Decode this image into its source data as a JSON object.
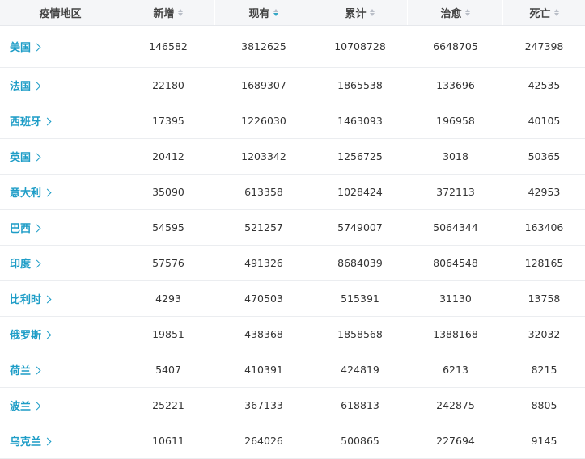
{
  "header": {
    "columns": [
      {
        "label": "疫情地区",
        "sortable": false,
        "sort": "none"
      },
      {
        "label": "新增",
        "sortable": true,
        "sort": "none"
      },
      {
        "label": "现有",
        "sortable": true,
        "sort": "desc"
      },
      {
        "label": "累计",
        "sortable": true,
        "sort": "none"
      },
      {
        "label": "治愈",
        "sortable": true,
        "sort": "none"
      },
      {
        "label": "死亡",
        "sortable": true,
        "sort": "none"
      }
    ]
  },
  "rows": [
    {
      "region": "美国",
      "new": "146582",
      "current": "3812625",
      "total": "10708728",
      "cured": "6648705",
      "dead": "247398"
    },
    {
      "region": "法国",
      "new": "22180",
      "current": "1689307",
      "total": "1865538",
      "cured": "133696",
      "dead": "42535"
    },
    {
      "region": "西班牙",
      "new": "17395",
      "current": "1226030",
      "total": "1463093",
      "cured": "196958",
      "dead": "40105"
    },
    {
      "region": "英国",
      "new": "20412",
      "current": "1203342",
      "total": "1256725",
      "cured": "3018",
      "dead": "50365"
    },
    {
      "region": "意大利",
      "new": "35090",
      "current": "613358",
      "total": "1028424",
      "cured": "372113",
      "dead": "42953"
    },
    {
      "region": "巴西",
      "new": "54595",
      "current": "521257",
      "total": "5749007",
      "cured": "5064344",
      "dead": "163406"
    },
    {
      "region": "印度",
      "new": "57576",
      "current": "491326",
      "total": "8684039",
      "cured": "8064548",
      "dead": "128165"
    },
    {
      "region": "比利时",
      "new": "4293",
      "current": "470503",
      "total": "515391",
      "cured": "31130",
      "dead": "13758"
    },
    {
      "region": "俄罗斯",
      "new": "19851",
      "current": "438368",
      "total": "1858568",
      "cured": "1388168",
      "dead": "32032"
    },
    {
      "region": "荷兰",
      "new": "5407",
      "current": "410391",
      "total": "424819",
      "cured": "6213",
      "dead": "8215"
    },
    {
      "region": "波兰",
      "new": "25221",
      "current": "367133",
      "total": "618813",
      "cured": "242875",
      "dead": "8805"
    },
    {
      "region": "乌克兰",
      "new": "10611",
      "current": "264026",
      "total": "500865",
      "cured": "227694",
      "dead": "9145"
    }
  ],
  "colors": {
    "accent": "#1e9dc7",
    "header_bg": "#f5f6f8",
    "sort_active": "#33a6c5"
  }
}
